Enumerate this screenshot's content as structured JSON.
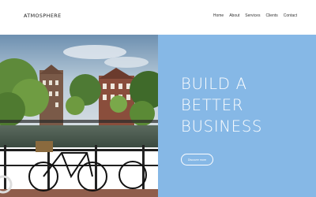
{
  "header": {
    "logo": "ATMOSPHERE",
    "nav": [
      {
        "label": "Home"
      },
      {
        "label": "About"
      },
      {
        "label": "Services"
      },
      {
        "label": "Clients"
      },
      {
        "label": "Contact"
      }
    ]
  },
  "hero": {
    "title": "BUILD A\nBETTER\nBUSINESS",
    "button_label": "Discover more",
    "panel_color": "#86b8e6"
  },
  "photo": {
    "subject": "Canal-side street with bicycles and trees"
  }
}
